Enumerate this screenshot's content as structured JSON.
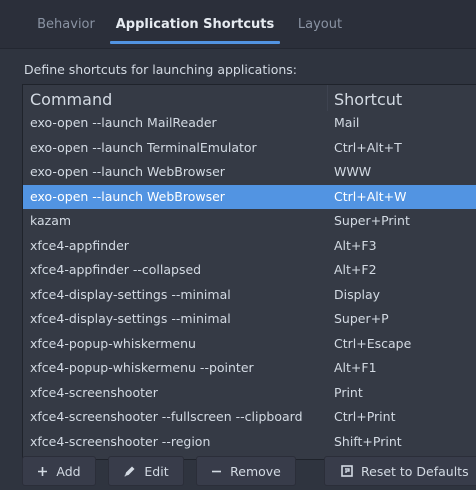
{
  "tabs": [
    "Behavior",
    "Application Shortcuts",
    "Layout"
  ],
  "description": "Define shortcuts for launching applications:",
  "table": {
    "headers": {
      "command": "Command",
      "shortcut": "Shortcut"
    },
    "rows": [
      {
        "command": "exo-open --launch MailReader",
        "shortcut": "Mail"
      },
      {
        "command": "exo-open --launch TerminalEmulator",
        "shortcut": "Ctrl+Alt+T"
      },
      {
        "command": "exo-open --launch WebBrowser",
        "shortcut": "WWW"
      },
      {
        "command": "exo-open --launch WebBrowser",
        "shortcut": "Ctrl+Alt+W"
      },
      {
        "command": "kazam",
        "shortcut": "Super+Print"
      },
      {
        "command": "xfce4-appfinder",
        "shortcut": "Alt+F3"
      },
      {
        "command": "xfce4-appfinder --collapsed",
        "shortcut": "Alt+F2"
      },
      {
        "command": "xfce4-display-settings --minimal",
        "shortcut": "Display"
      },
      {
        "command": "xfce4-display-settings --minimal",
        "shortcut": "Super+P"
      },
      {
        "command": "xfce4-popup-whiskermenu",
        "shortcut": "Ctrl+Escape"
      },
      {
        "command": "xfce4-popup-whiskermenu --pointer",
        "shortcut": "Alt+F1"
      },
      {
        "command": "xfce4-screenshooter",
        "shortcut": "Print"
      },
      {
        "command": "xfce4-screenshooter --fullscreen --clipboard",
        "shortcut": "Ctrl+Print"
      },
      {
        "command": "xfce4-screenshooter --region",
        "shortcut": "Shift+Print"
      }
    ]
  },
  "buttons": {
    "add": "Add",
    "edit": "Edit",
    "remove": "Remove",
    "reset": "Reset to Defaults"
  },
  "icons": {
    "add": "plus-icon",
    "edit": "pencil-icon",
    "remove": "minus-icon",
    "reset": "reset-icon"
  },
  "colors": {
    "accent": "#5294e2",
    "background": "#2f343f"
  }
}
